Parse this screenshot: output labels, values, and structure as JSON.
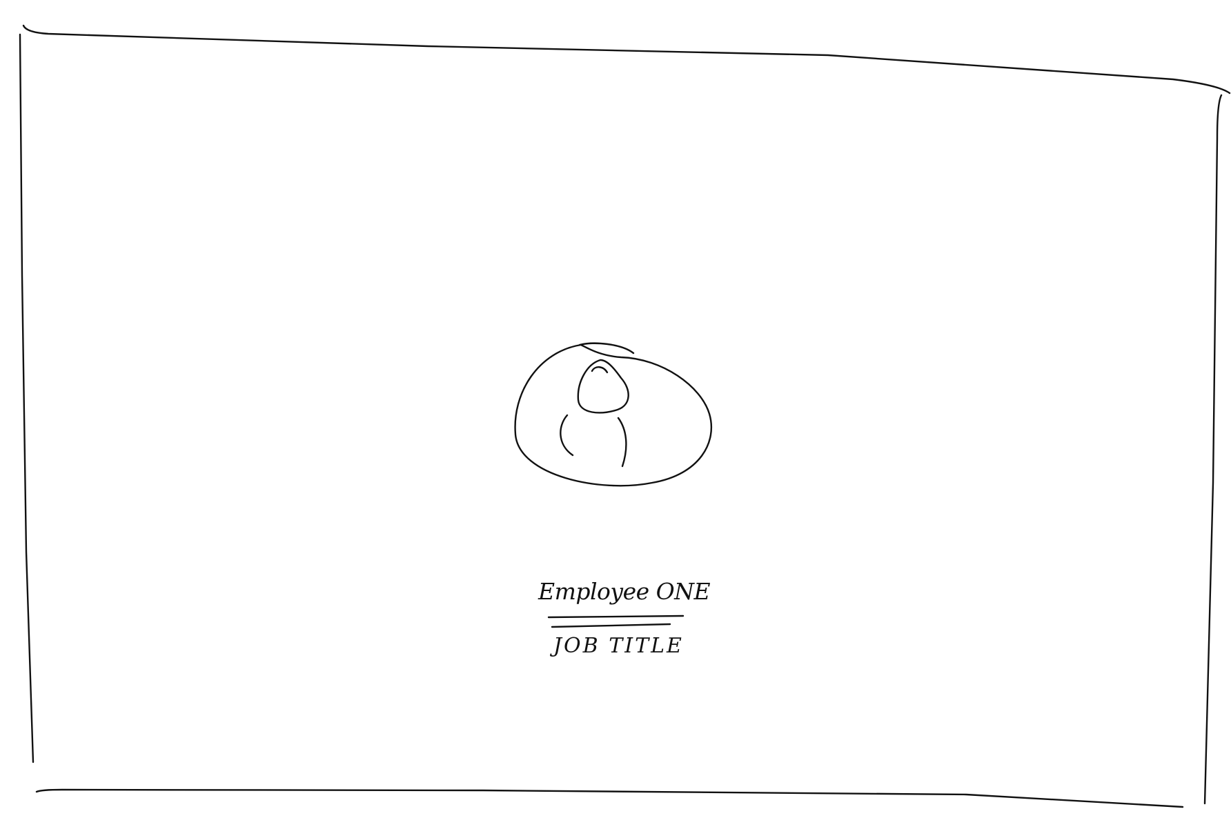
{
  "employee": {
    "name": "Employee ONE",
    "job_title": "JOB TITLE"
  },
  "icons": {
    "avatar": "user-avatar-icon"
  },
  "colors": {
    "ink": "#111111",
    "background": "#ffffff"
  }
}
